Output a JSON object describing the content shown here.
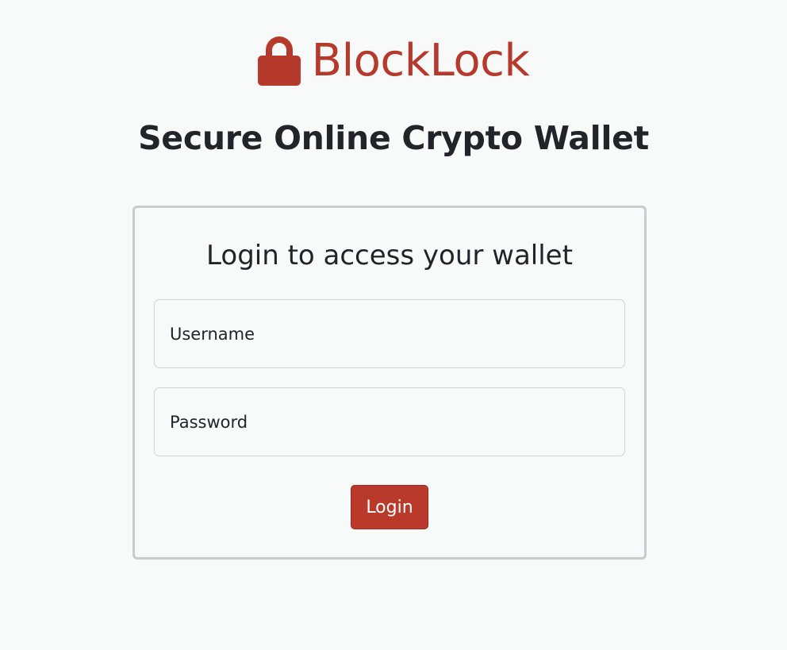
{
  "brand": {
    "icon": "lock-icon",
    "name": "BlockLock",
    "color": "#b63a2b"
  },
  "tagline": "Secure Online Crypto Wallet",
  "login_card": {
    "title": "Login to access your wallet",
    "username": {
      "placeholder": "Username",
      "value": ""
    },
    "password": {
      "placeholder": "Password",
      "value": ""
    },
    "login_label": "Login",
    "button_color": "#b93a2b"
  }
}
